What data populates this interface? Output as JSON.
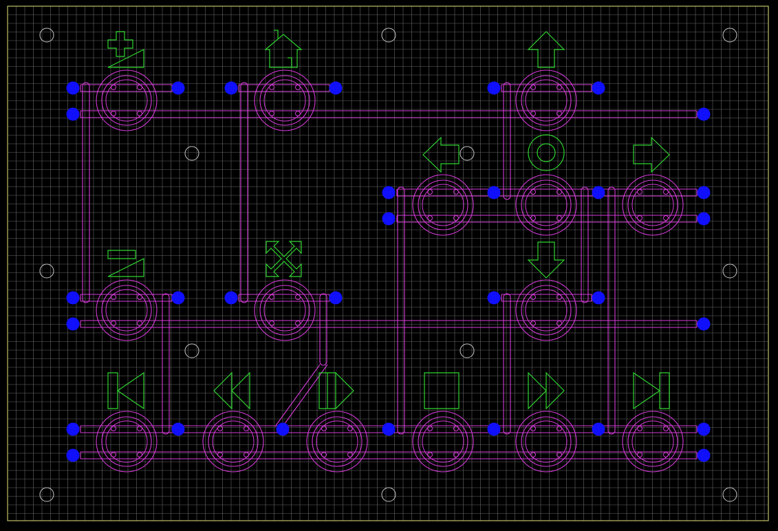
{
  "colors": {
    "background": "#000000",
    "grid": "#8a8a8a",
    "border": "#e6e67a",
    "trace": "#d43ad8",
    "silkscreen": "#2fd62f",
    "pad": "#1010ff",
    "hole": "#c8c8c8"
  },
  "grid": {
    "step": 12.5
  },
  "buttons": [
    {
      "id": "btn-1",
      "icon": "zoom-in-icon"
    },
    {
      "id": "btn-2",
      "icon": "home-icon"
    },
    {
      "id": "btn-3",
      "icon": "arrow-up-icon"
    },
    {
      "id": "btn-4",
      "icon": "arrow-left-icon"
    },
    {
      "id": "btn-5",
      "icon": "circle-ok-icon"
    },
    {
      "id": "btn-6",
      "icon": "arrow-right-icon"
    },
    {
      "id": "btn-7",
      "icon": "zoom-out-icon"
    },
    {
      "id": "btn-8",
      "icon": "fullscreen-icon"
    },
    {
      "id": "btn-9",
      "icon": "arrow-down-icon"
    },
    {
      "id": "btn-10",
      "icon": "skip-back-icon"
    },
    {
      "id": "btn-11",
      "icon": "rewind-icon"
    },
    {
      "id": "btn-12",
      "icon": "play-pause-icon"
    },
    {
      "id": "btn-13",
      "icon": "stop-icon"
    },
    {
      "id": "btn-14",
      "icon": "fast-forward-icon"
    },
    {
      "id": "btn-15",
      "icon": "skip-forward-icon"
    }
  ]
}
